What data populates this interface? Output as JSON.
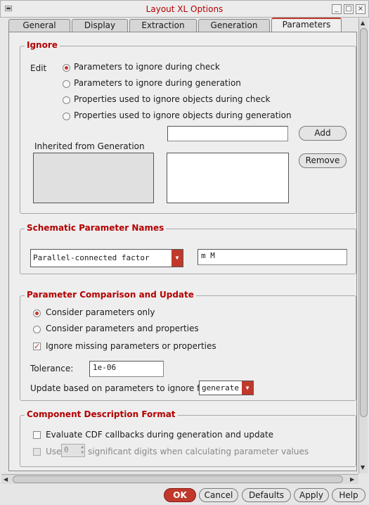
{
  "window": {
    "title": "Layout XL Options"
  },
  "tabs": [
    {
      "label": "General"
    },
    {
      "label": "Display"
    },
    {
      "label": "Extraction"
    },
    {
      "label": "Generation"
    },
    {
      "label": "Parameters",
      "active": true
    }
  ],
  "ignore": {
    "title": "Ignore",
    "edit_label": "Edit",
    "options": [
      {
        "label": "Parameters to ignore during check",
        "selected": true
      },
      {
        "label": "Parameters to ignore during generation",
        "selected": false
      },
      {
        "label": "Properties used to ignore objects during check",
        "selected": false
      },
      {
        "label": "Properties used to ignore objects during generation",
        "selected": false
      }
    ],
    "new_value": "",
    "inherited_label": "Inherited from Generation",
    "add_label": "Add",
    "remove_label": "Remove"
  },
  "schematic": {
    "title": "Schematic Parameter Names",
    "selected": "Parallel-connected factor",
    "value": "m M"
  },
  "comparison": {
    "title": "Parameter Comparison and Update",
    "options": [
      {
        "label": "Consider parameters only",
        "selected": true
      },
      {
        "label": "Consider parameters and properties",
        "selected": false
      }
    ],
    "ignore_missing_label": "Ignore missing parameters or properties",
    "ignore_missing_checked": true,
    "tolerance_label": "Tolerance:",
    "tolerance_value": "1e-06",
    "update_label": "Update based on parameters to ignore for",
    "update_value": "generate"
  },
  "cdf": {
    "title": "Component Description Format",
    "evaluate_label": "Evaluate CDF callbacks during generation and update",
    "evaluate_checked": false,
    "use_label": "Use",
    "digits_value": "0",
    "digits_suffix": "significant digits when calculating parameter values",
    "use_checked": false
  },
  "footer": {
    "ok": "OK",
    "cancel": "Cancel",
    "defaults": "Defaults",
    "apply": "Apply",
    "help": "Help"
  },
  "colors": {
    "accent": "#c0392b",
    "title_red": "#b30000"
  }
}
